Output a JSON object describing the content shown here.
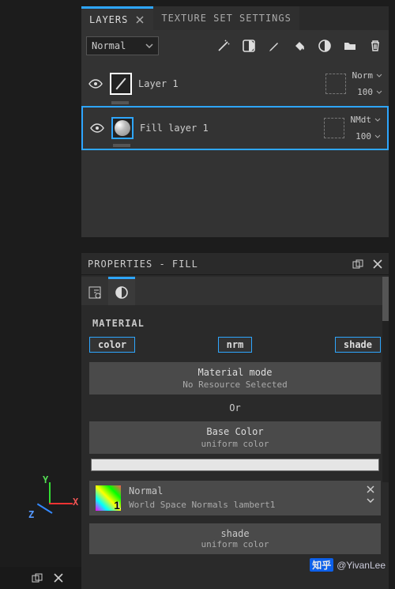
{
  "tabs": {
    "layers": "LAYERS",
    "texset": "TEXTURE SET SETTINGS"
  },
  "blend_mode": "Normal",
  "layers": [
    {
      "name": "Layer 1",
      "blend": "Norm",
      "opacity": "100"
    },
    {
      "name": "Fill layer 1",
      "blend": "NMdt",
      "opacity": "100"
    }
  ],
  "properties": {
    "title": "PROPERTIES - FILL",
    "section": "MATERIAL",
    "channels": {
      "color": "color",
      "nrm": "nrm",
      "shade": "shade"
    },
    "material_mode": {
      "label": "Material mode",
      "value": "No Resource Selected"
    },
    "or": "Or",
    "base_color": {
      "label": "Base Color",
      "value": "uniform color"
    },
    "normal": {
      "label": "Normal",
      "sub": "World Space Normals lambert1"
    },
    "shade": {
      "label": "shade",
      "value": "uniform color"
    }
  },
  "axes": {
    "x": "X",
    "y": "Y",
    "z": "Z"
  },
  "watermark": {
    "logo": "知乎",
    "user": "@YivanLee"
  }
}
